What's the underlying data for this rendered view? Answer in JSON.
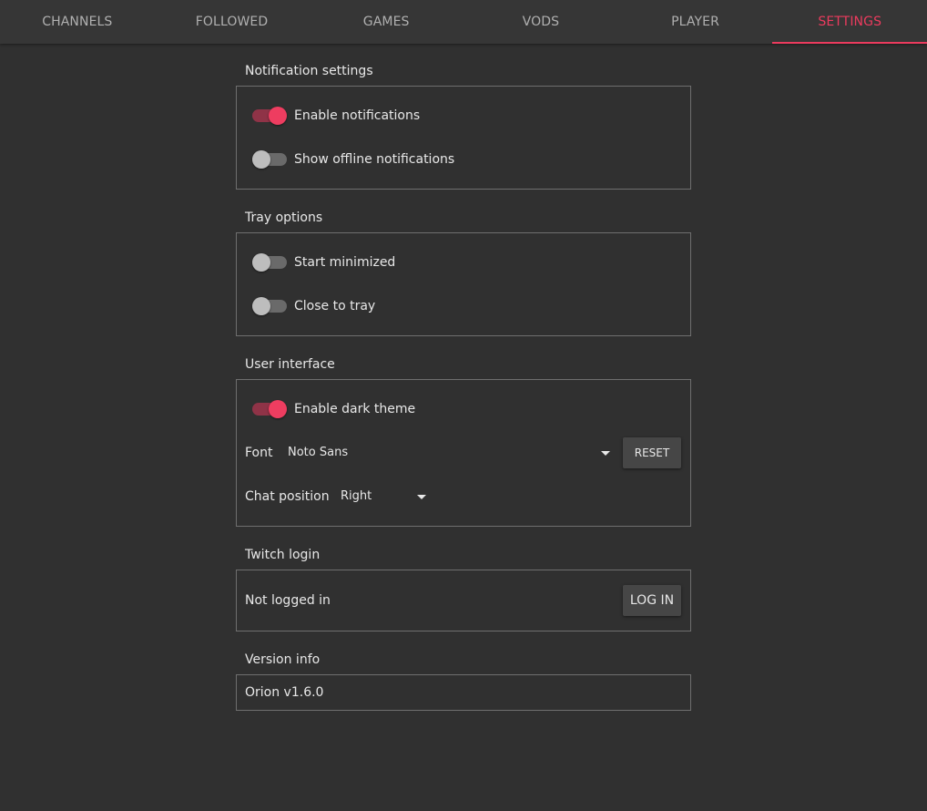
{
  "tabs": [
    {
      "label": "CHANNELS"
    },
    {
      "label": "FOLLOWED"
    },
    {
      "label": "GAMES"
    },
    {
      "label": "VODS"
    },
    {
      "label": "PLAYER"
    },
    {
      "label": "SETTINGS",
      "active": true
    }
  ],
  "notification_settings": {
    "title": "Notification settings",
    "enable_notifications": {
      "label": "Enable notifications",
      "checked": true
    },
    "show_offline_notifications": {
      "label": "Show offline notifications",
      "checked": false
    }
  },
  "tray_options": {
    "title": "Tray options",
    "start_minimized": {
      "label": "Start minimized",
      "checked": false
    },
    "close_to_tray": {
      "label": "Close to tray",
      "checked": false
    }
  },
  "user_interface": {
    "title": "User interface",
    "enable_dark_theme": {
      "label": "Enable dark theme",
      "checked": true
    },
    "font": {
      "label": "Font",
      "value": "Noto Sans",
      "reset_label": "RESET"
    },
    "chat_position": {
      "label": "Chat position",
      "value": "Right"
    }
  },
  "twitch_login": {
    "title": "Twitch login",
    "status": "Not logged in",
    "login_label": "LOG IN"
  },
  "version_info": {
    "title": "Version info",
    "version": "Orion v1.6.0"
  },
  "colors": {
    "accent": "#ec3b5e",
    "background": "#303030",
    "tabbar": "#363636",
    "border": "#6f6f6f"
  }
}
